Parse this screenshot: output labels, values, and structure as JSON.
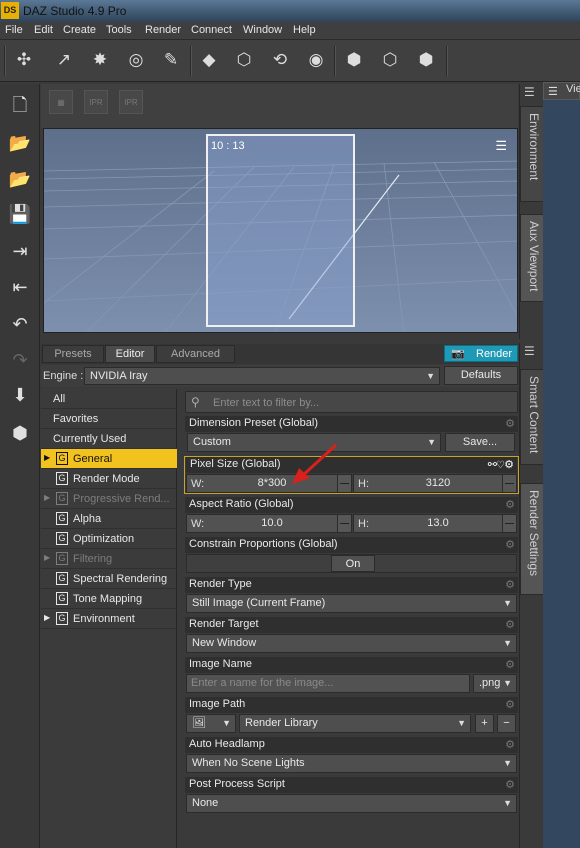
{
  "window": {
    "logo": "DS",
    "title": "DAZ Studio 4.9 Pro"
  },
  "menu": [
    "File",
    "Edit",
    "Create",
    "Tools",
    "Render",
    "Connect",
    "Window",
    "Help"
  ],
  "toolbar_icons": [
    "add-node-icon",
    "spotlight-icon",
    "distant-light-icon",
    "point-light-icon",
    "linear-light-icon",
    "primitive-icon",
    "node-selection-icon",
    "universal-tool-icon",
    "rotate-tool-icon",
    "active-pose-icon",
    "joint-editor-icon",
    "node-add-icon",
    "geometry-editor-icon"
  ],
  "left_tools": [
    "new-file-icon",
    "open-file-icon",
    "merge-file-icon",
    "save-file-icon",
    "import-icon",
    "export-icon",
    "undo-icon",
    "redo-icon",
    "download-figure-icon",
    "figure-setup-icon"
  ],
  "viewport": {
    "timecode": "10 : 13",
    "ipr_labels": [
      "IPR",
      "IPR"
    ]
  },
  "side_tabs_top": [
    "Environment",
    "Aux Viewport"
  ],
  "side_tabs_bottom": [
    "Smart Content",
    "Render Settings"
  ],
  "right_view_label": "Vie",
  "pane_tabs": {
    "presets": "Presets",
    "editor": "Editor",
    "advanced": "Advanced",
    "render": "Render"
  },
  "engine": {
    "label": "Engine :",
    "value": "NVIDIA Iray",
    "defaults_label": "Defaults"
  },
  "categories": [
    {
      "label": "All",
      "selected": false
    },
    {
      "label": "Favorites"
    },
    {
      "label": "Currently Used"
    },
    {
      "label": "General",
      "selected": true
    },
    {
      "label": "Render Mode"
    },
    {
      "label": "Progressive Rend..."
    },
    {
      "label": "Alpha"
    },
    {
      "label": "Optimization"
    },
    {
      "label": "Filtering"
    },
    {
      "label": "Spectral Rendering"
    },
    {
      "label": "Tone Mapping"
    },
    {
      "label": "Environment"
    }
  ],
  "group_badge": "G",
  "filter": {
    "placeholder": "Enter text to filter by..."
  },
  "props": {
    "dimension_preset": {
      "title": "Dimension Preset (Global)",
      "value": "Custom",
      "save_label": "Save..."
    },
    "pixel_size": {
      "title": "Pixel Size (Global)",
      "w_label": "W:",
      "w_value": "8*300",
      "h_label": "H:",
      "h_value": "3120"
    },
    "aspect_ratio": {
      "title": "Aspect Ratio (Global)",
      "w_label": "W:",
      "w_value": "10.0",
      "h_label": "H:",
      "h_value": "13.0"
    },
    "constrain": {
      "title": "Constrain Proportions (Global)",
      "value": "On"
    },
    "render_type": {
      "title": "Render Type",
      "value": "Still Image (Current Frame)"
    },
    "render_target": {
      "title": "Render Target",
      "value": "New Window"
    },
    "image_name": {
      "title": "Image Name",
      "placeholder": "Enter a name for the image...",
      "ext": ".png"
    },
    "image_path": {
      "title": "Image Path",
      "value": "Render Library",
      "plus": "+",
      "minus": "−"
    },
    "auto_headlamp": {
      "title": "Auto Headlamp",
      "value": "When No Scene Lights"
    },
    "post_process": {
      "title": "Post Process Script",
      "value": "None"
    }
  },
  "colors": {
    "accent": "#f2c21e",
    "render_button": "#1f9ab6",
    "annotation_arrow": "#d8201c"
  }
}
